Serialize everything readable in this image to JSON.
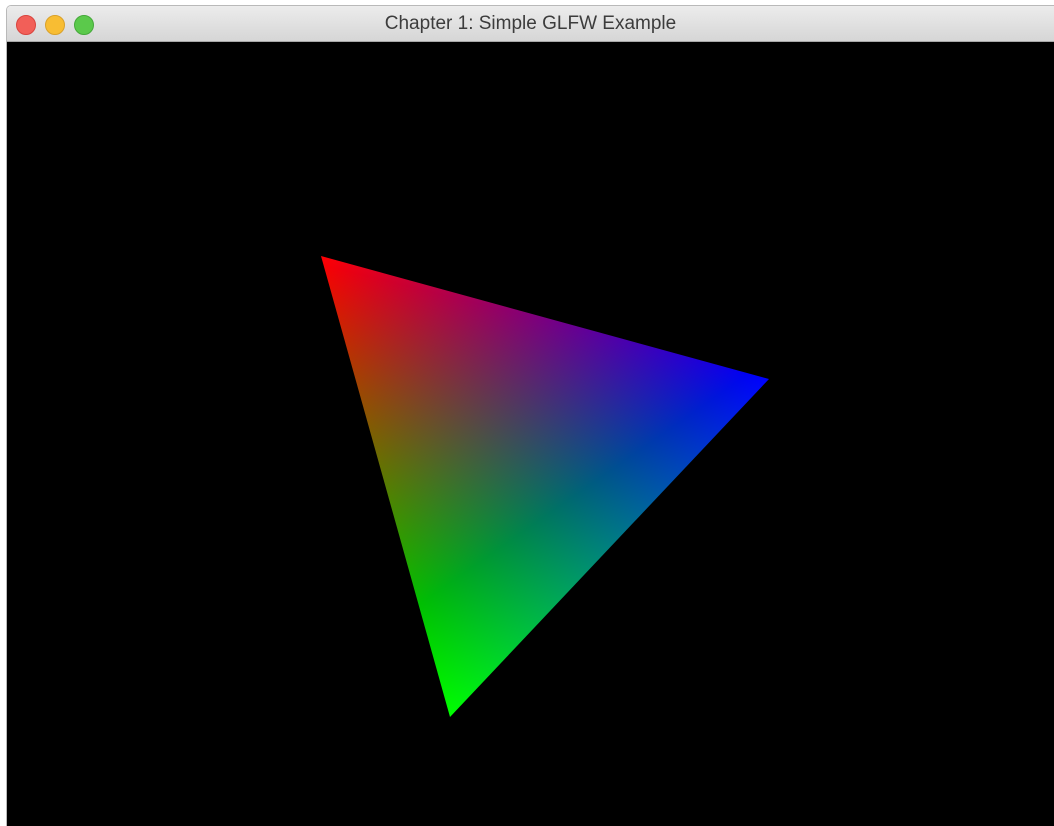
{
  "window": {
    "title": "Chapter 1: Simple GLFW Example",
    "buttons": {
      "close": "close-button",
      "minimize": "minimize-button",
      "zoom": "zoom-button"
    }
  },
  "scene": {
    "background_color": "#000000",
    "triangle_vertex_colors": [
      "#ff0000",
      "#00ff00",
      "#0000ff"
    ]
  }
}
